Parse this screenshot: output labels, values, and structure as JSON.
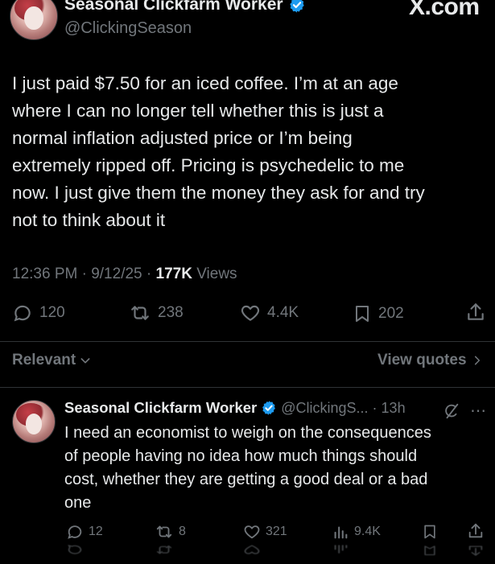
{
  "header": {
    "display_name": "Seasonal Clickfarm Worker",
    "handle": "@ClickingSeason",
    "brand": "X.com"
  },
  "tweet": {
    "lines": [
      "I just paid $7.50 for an iced coffee. I’m at an age",
      "where I can no longer tell whether this is just a",
      "normal inflation adjusted price or I’m being",
      "extremely ripped off. Pricing is psychedelic to me",
      "now.  I just give them the money they ask for and try",
      "not to think about it"
    ],
    "timestamp": "12:36 PM · 9/12/25 · ",
    "views_count": "177K",
    "views_label": " Views",
    "replies": "120",
    "reposts": "238",
    "likes": "4.4K",
    "bookmarks": "202"
  },
  "replies_header": {
    "sort_label": "Relevant",
    "quotes_label": "View quotes"
  },
  "reply": {
    "display_name": "Seasonal Clickfarm Worker",
    "handle_time": "@ClickingS... · 13h",
    "lines": [
      "I need an economist to weigh on the consequences",
      "of people having no idea how much things should",
      "cost, whether they are getting a good deal or a bad",
      "one"
    ],
    "replies": "12",
    "reposts": "8",
    "likes": "321",
    "views": "9.4K"
  },
  "colors": {
    "background": "#000000",
    "text": "#e7e9ea",
    "muted": "#71767b",
    "verified": "#1d9bf0",
    "divider": "#2f3336"
  }
}
